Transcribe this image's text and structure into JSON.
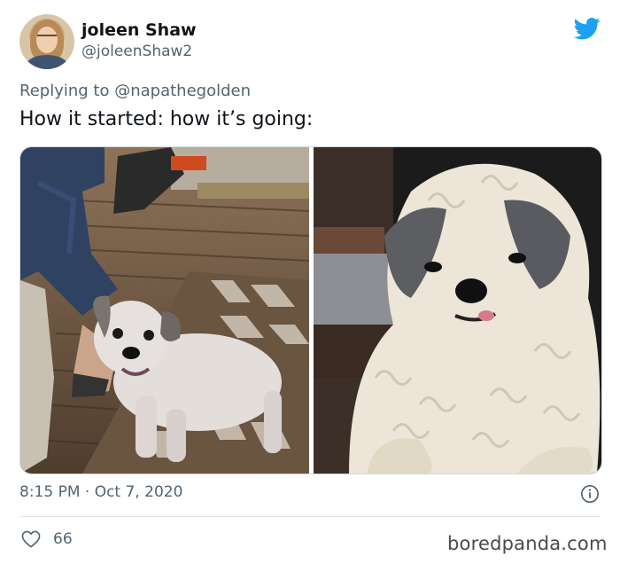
{
  "tweet": {
    "author_name": "joleen Shaw",
    "author_handle": "@joleenShaw2",
    "reply_prefix": "Replying to",
    "reply_to": "@napathegolden",
    "text": "How it started: how it’s going:",
    "timestamp": "8:15 PM · Oct 7, 2020",
    "like_count": "66"
  },
  "icons": {
    "brand": "twitter-bird-icon",
    "info": "info-icon",
    "like": "heart-icon"
  },
  "colors": {
    "twitter_blue": "#1da1f2",
    "secondary_text": "#536471"
  },
  "watermark": "boredpanda.com"
}
